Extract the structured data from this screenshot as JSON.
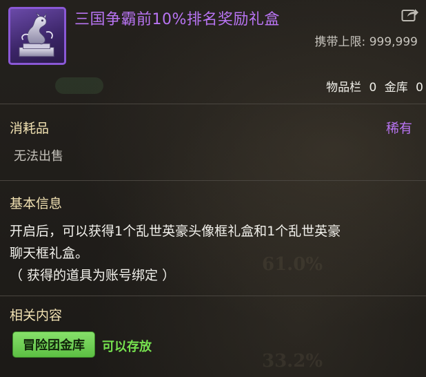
{
  "item": {
    "title": "三国争霸前10%排名奖励礼盒",
    "icon": "dragon-statue-icon",
    "carry_label": "携带上限:",
    "carry_value": "999,999",
    "inventory_label": "物品栏",
    "inventory_count": "0",
    "vault_label": "金库",
    "vault_count": "0"
  },
  "category": {
    "type_label": "消耗品",
    "rarity": "稀有",
    "sell_status": "无法出售"
  },
  "basic_info": {
    "heading": "基本信息",
    "lines": [
      "开启后，可以获得1个乱世英豪头像框礼盒和1个乱世英豪",
      "聊天框礼盒。",
      "（ 获得的道具为账号绑定 ）"
    ]
  },
  "related": {
    "heading": "相关内容",
    "button_label": "冒险团金库",
    "status": "可以存放"
  },
  "background": {
    "percent_1": "61.0%",
    "percent_2": "33.2%"
  },
  "colors": {
    "title_purple": "#b874f2",
    "heading_gold": "#f1e1b2",
    "button_green": "#6fd353",
    "status_green": "#76e24f"
  }
}
